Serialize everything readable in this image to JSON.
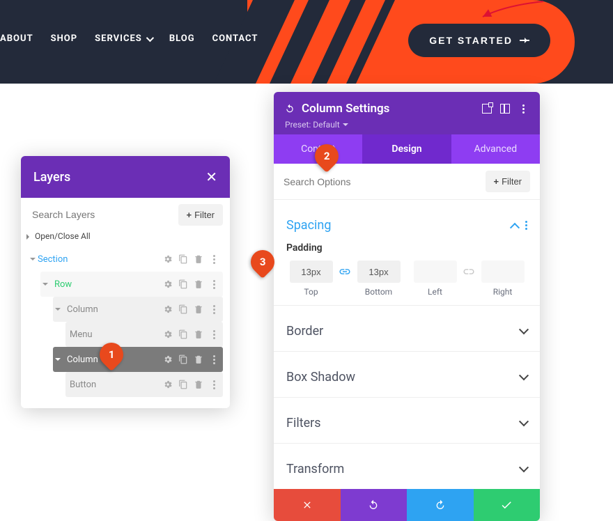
{
  "header": {
    "nav": [
      "ABOUT",
      "SHOP",
      "SERVICES",
      "BLOG",
      "CONTACT"
    ],
    "nav_has_dropdown": [
      false,
      false,
      true,
      false,
      false
    ],
    "cta": "GET STARTED"
  },
  "layers_panel": {
    "title": "Layers",
    "search_placeholder": "Search Layers",
    "filter_label": "Filter",
    "open_close_all": "Open/Close All",
    "items": {
      "section": "Section",
      "row": "Row",
      "column1": "Column",
      "menu": "Menu",
      "column2": "Column",
      "button": "Button"
    }
  },
  "column_settings": {
    "title": "Column Settings",
    "preset_label": "Preset: Default",
    "tabs": [
      "Content",
      "Design",
      "Advanced"
    ],
    "active_tab": 1,
    "search_placeholder": "Search Options",
    "filter_label": "Filter",
    "spacing": {
      "title": "Spacing",
      "padding_label": "Padding",
      "top_value": "13px",
      "bottom_value": "13px",
      "left_value": "",
      "right_value": "",
      "labels": {
        "top": "Top",
        "bottom": "Bottom",
        "left": "Left",
        "right": "Right"
      }
    },
    "collapsed_sections": [
      "Border",
      "Box Shadow",
      "Filters",
      "Transform"
    ]
  },
  "callouts": {
    "c1": "1",
    "c2": "2",
    "c3": "3"
  }
}
